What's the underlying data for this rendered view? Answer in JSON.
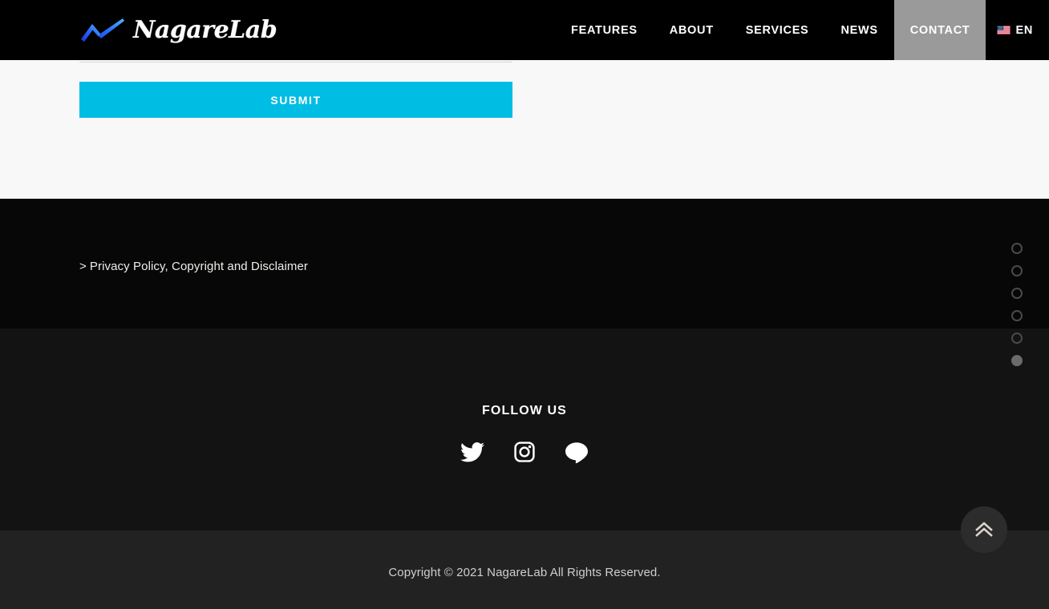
{
  "header": {
    "logo_text": "NagareLab",
    "logo_icon": "chart-arrow-logo-icon",
    "nav_items": [
      {
        "label": "FEATURES",
        "active": false
      },
      {
        "label": "ABOUT",
        "active": false
      },
      {
        "label": "SERVICES",
        "active": false
      },
      {
        "label": "NEWS",
        "active": false
      },
      {
        "label": "CONTACT",
        "active": true
      }
    ],
    "language": {
      "label": "EN",
      "flag_icon": "us-flag-icon"
    },
    "colors": {
      "background": "#000000",
      "active_nav_bg": "#9a9a9a"
    }
  },
  "contact_form": {
    "submit_label": "SUBMIT",
    "message_value": "",
    "message_placeholder": "",
    "accent_color": "#00bde4",
    "section_bg": "#f8f8f8"
  },
  "privacy": {
    "caret": ">",
    "link_label": "Privacy Policy, Copyright and Disclaimer",
    "section_bg": "#070707"
  },
  "follow": {
    "title": "FOLLOW US",
    "section_bg": "#131313",
    "socials": [
      {
        "name": "twitter-icon",
        "label": "Twitter"
      },
      {
        "name": "instagram-icon",
        "label": "Instagram"
      },
      {
        "name": "chat-bubble-icon",
        "label": "LINE"
      }
    ]
  },
  "footer": {
    "copyright": "Copyright © 2021 NagareLab All Rights Reserved.",
    "section_bg": "#222222"
  },
  "dot_nav": {
    "count": 6,
    "active_index": 5,
    "dots": [
      {
        "active": false
      },
      {
        "active": false
      },
      {
        "active": false
      },
      {
        "active": false
      },
      {
        "active": false
      },
      {
        "active": true
      }
    ]
  },
  "scroll_top": {
    "icon": "double-chevron-up-icon",
    "label": "Back to top"
  }
}
